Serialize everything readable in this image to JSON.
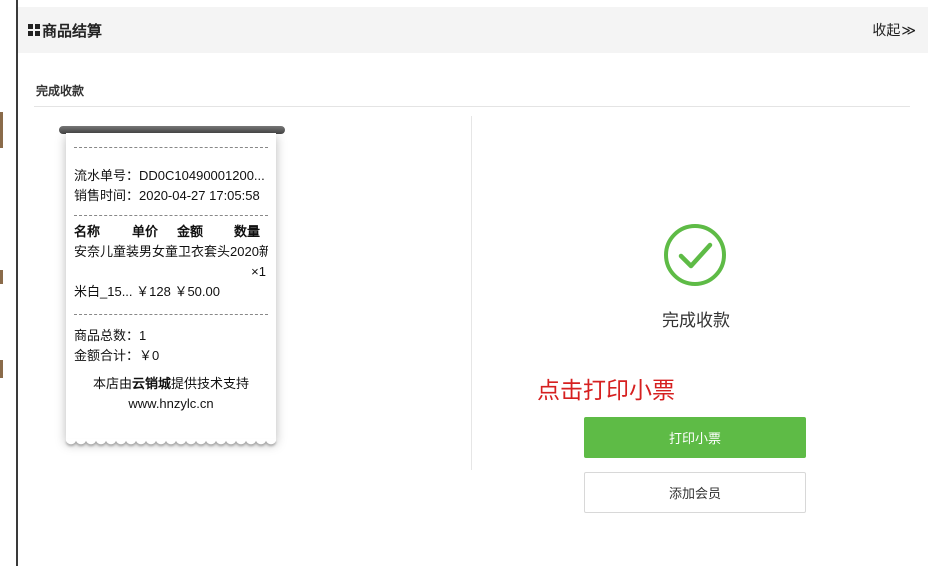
{
  "header": {
    "title": "商品结算",
    "collapse_label": "收起",
    "collapse_icon": "chevron-double-right-icon"
  },
  "section": {
    "title": "完成收款"
  },
  "receipt": {
    "serial_line": "流水单号：DD0C10490001200...",
    "time_line": "销售时间：2020-04-27 17:05:58",
    "col_name": "名称",
    "col_price": "单价",
    "col_amount": "金额",
    "col_qty": "数量",
    "item_name": "安奈儿童装男女童卫衣套头2020新",
    "item_qty": "×1",
    "item_line": "米白_15... ￥128   ￥50.00",
    "total_count": "商品总数：1",
    "total_amount": "金额合计：￥0",
    "footer_prefix": "本店由",
    "footer_brand": "云销城",
    "footer_suffix": "提供技术支持",
    "website": "www.hnzylc.cn"
  },
  "status": {
    "icon": "check-circle-icon",
    "text": "完成收款",
    "color": "#5ebb46"
  },
  "annotation": "点击打印小票",
  "actions": {
    "print_label": "打印小票",
    "member_label": "添加会员"
  }
}
